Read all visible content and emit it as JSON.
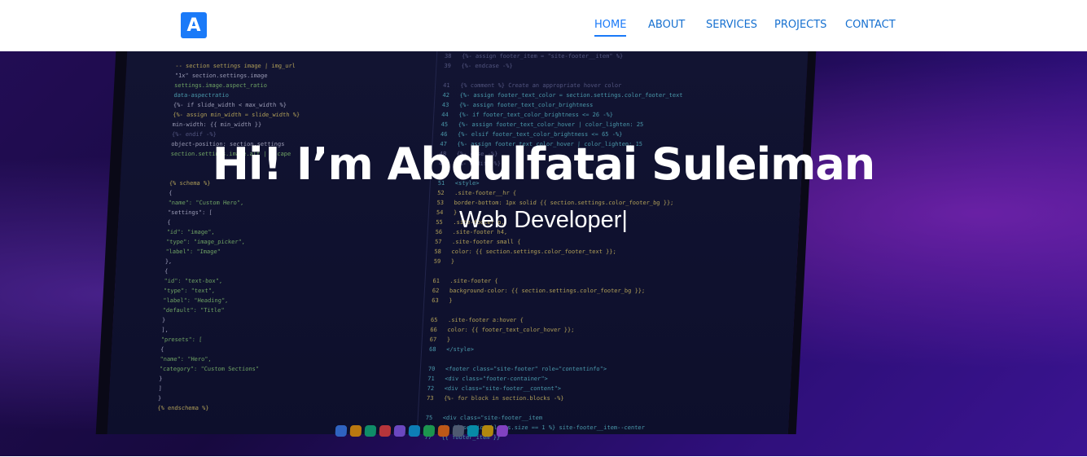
{
  "brand": {
    "logo_letter": "A",
    "logo_color": "#1a7af8"
  },
  "nav": {
    "items": [
      {
        "label": "HOME",
        "active": true
      },
      {
        "label": "ABOUT",
        "active": false
      },
      {
        "label": "SERVICES",
        "active": false
      },
      {
        "label": "PROJECTS",
        "active": false
      },
      {
        "label": "CONTACT",
        "active": false
      }
    ]
  },
  "hero": {
    "greeting": "Hi! I’m ",
    "name": "Abdulfatai Suleiman",
    "role": "Web Developer",
    "cursor": "|"
  },
  "colors": {
    "accent": "#1a7af8",
    "hero_bg": "#2a0f66"
  }
}
